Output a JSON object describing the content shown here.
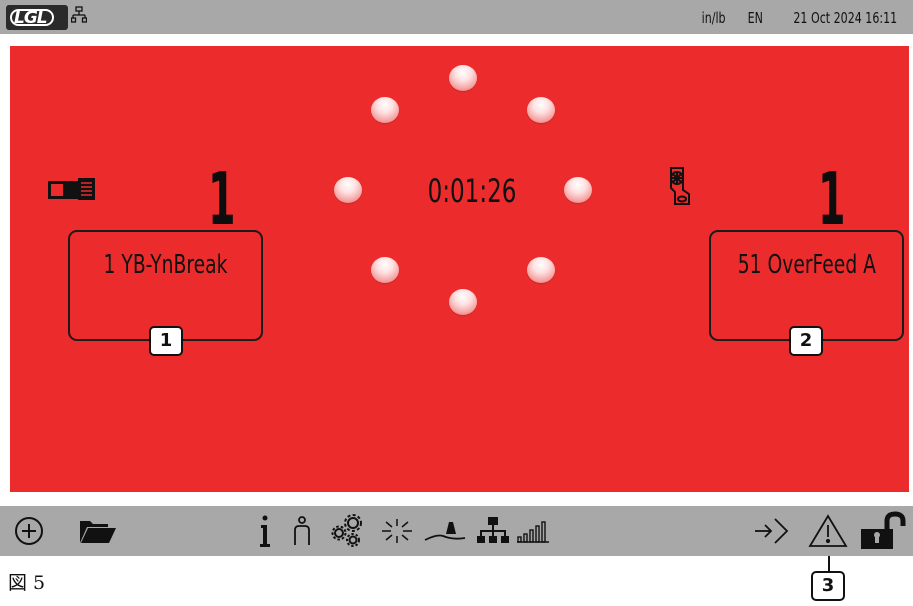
{
  "status_bar": {
    "logo_text": "LGL",
    "network_icon": "network-icon",
    "units": "in/lb",
    "language": "EN",
    "datetime": "21 Oct 2024 16:11"
  },
  "main": {
    "background_color": "#ec2c2c",
    "left_feeder": {
      "icon": "feeder-icon",
      "count": "1",
      "stop_label": "1 YB-YnBreak",
      "callout": "1"
    },
    "right_feeder": {
      "icon": "sensor-icon",
      "count": "1",
      "stop_label": "51 OverFeed A",
      "callout": "2"
    },
    "timer": "0:01:26",
    "indicator_lights": 8
  },
  "toolbar": {
    "left_icons": [
      "add-icon",
      "folder-icon"
    ],
    "center_icons": [
      "info-icon",
      "operator-icon",
      "settings-icon",
      "sparkle-icon",
      "tension-icon",
      "network-icon",
      "signal-bars-icon"
    ],
    "right_icons": [
      "login-icon",
      "warning-icon",
      "unlock-icon"
    ]
  },
  "caption": "図 5",
  "bottom_callout": "3"
}
